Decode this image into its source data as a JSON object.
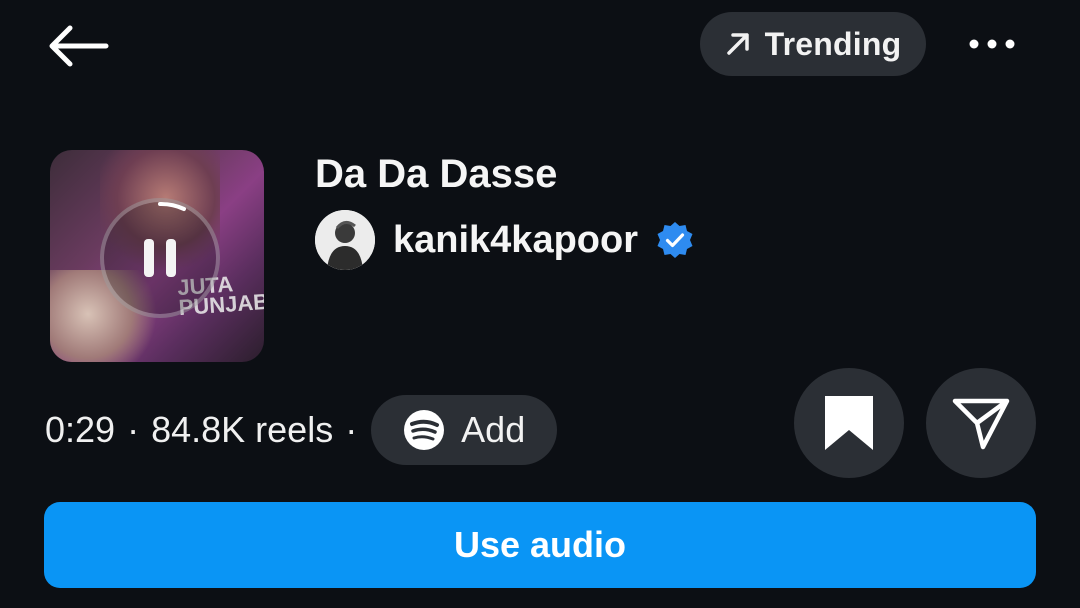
{
  "header": {
    "back_icon": "arrow-left-icon",
    "trending_icon": "arrow-up-right-icon",
    "trending_label": "Trending",
    "more_icon": "more-horizontal-icon"
  },
  "track": {
    "title": "Da Da Dasse",
    "artist": "kanik4kapoor",
    "verified": true,
    "playback_state": "playing",
    "cover_text": "JUTA PUNJAB"
  },
  "meta": {
    "duration": "0:29",
    "separator": "·",
    "reels_count": "84.8K reels",
    "add_label": "Add",
    "add_icon": "spotify-icon"
  },
  "actions": {
    "save_icon": "bookmark-icon",
    "share_icon": "send-icon",
    "use_audio_label": "Use audio"
  },
  "colors": {
    "background": "#0c0f14",
    "pill": "#2b2f35",
    "accent": "#0a95f5",
    "verified": "#2e8bf0"
  }
}
